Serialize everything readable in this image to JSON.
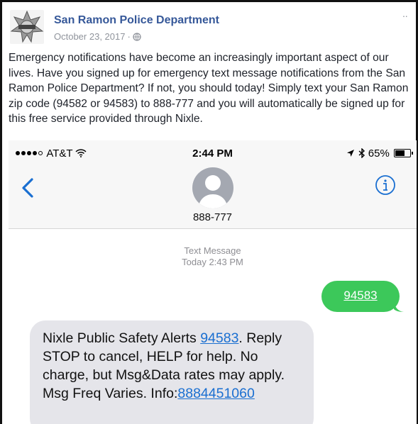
{
  "post": {
    "page_name": "San Ramon Police Department",
    "date": "October 23, 2017",
    "separator": "·",
    "more": "··",
    "text": "Emergency notifications have become an increasingly important aspect of our lives. Have you signed up for emergency text message notifications from the San Ramon Police Department? If not, you should today! Simply text your San Ramon zip code (94582 or 94583) to 888-777 and you will automatically be signed up for this free service provided through Nixle."
  },
  "phone": {
    "status": {
      "carrier": "AT&T",
      "time": "2:44 PM",
      "battery": "65%",
      "battery_level": 0.65
    },
    "contact_number": "888-777",
    "thread_label": "Text Message",
    "thread_time": "Today 2:43 PM",
    "sent_message": "94583",
    "received": {
      "part1": "Nixle Public Safety Alerts ",
      "link1": "94583",
      "part2": ". Reply STOP to cancel, HELP for help. No charge, but Msg&Data rates may apply. Msg Freq Varies. Info:",
      "link2": "8884451060"
    }
  },
  "colors": {
    "link_blue": "#365899",
    "ios_blue": "#1a6fd1",
    "sent_green": "#3cc85a",
    "received_gray": "#e5e5ea"
  }
}
